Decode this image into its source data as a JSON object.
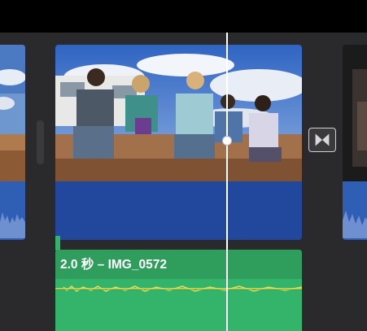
{
  "timeline": {
    "main_clip": {
      "name": "IMG_0572"
    },
    "audio_clip": {
      "label": "2.0 秒 – IMG_0572"
    },
    "transition": {
      "icon": "cross-dissolve-icon"
    },
    "colors": {
      "background": "#000000",
      "track": "#2a2a2c",
      "audio_blue": "#21489c",
      "audio_green": "#33b46a",
      "playhead": "#ffffff"
    }
  }
}
